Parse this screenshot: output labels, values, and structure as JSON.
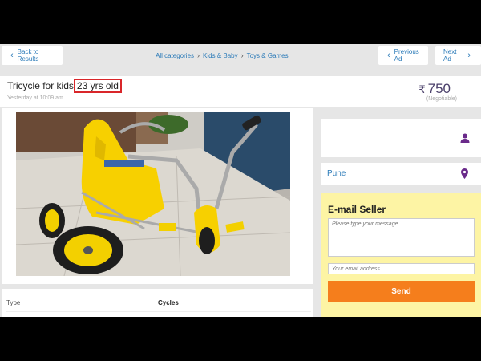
{
  "nav": {
    "back": "Back to Results",
    "breadcrumbs": [
      "All categories",
      "Kids & Baby",
      "Toys & Games"
    ],
    "previous": "Previous Ad",
    "next": "Next Ad"
  },
  "ad": {
    "title_prefix": "Tricycle for kids",
    "title_highlight": "23 yrs old",
    "posted": "Yesterday at 10:09 am",
    "currency_symbol": "₹",
    "price": "750",
    "negotiable": "(Negotiable)"
  },
  "seller": {
    "location": "Pune"
  },
  "email_form": {
    "title": "E-mail Seller",
    "message_placeholder": "Please type your message...",
    "email_placeholder": "Your email address",
    "send_label": "Send"
  },
  "details": {
    "label": "Type",
    "value": "Cycles"
  },
  "colors": {
    "link": "#2a7ab8",
    "price": "#4a3f6a",
    "highlight_box": "#d9262a",
    "send_button": "#f57e1c",
    "email_panel": "#fdf4a4",
    "icon": "#6a2a8a"
  }
}
